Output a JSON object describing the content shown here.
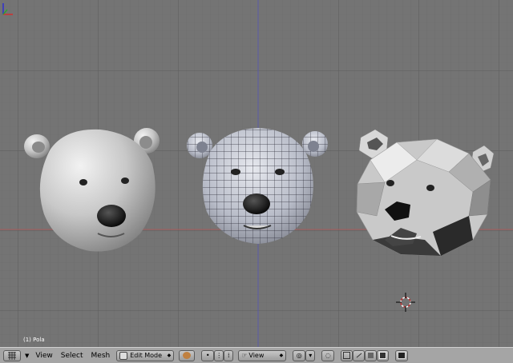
{
  "viewport": {
    "object_label": "(1) Pola",
    "background": "#747474",
    "grid_color": "#6a6a6a",
    "x_axis_color": "#b05050",
    "y_axis_color": "#5050b0"
  },
  "header": {
    "menus": [
      "View",
      "Select",
      "Mesh"
    ],
    "mode_label": "Edit Mode",
    "view_dropdown_label": "View"
  },
  "icons": {
    "window_type": "grid-icon",
    "menu_collapse": "triangle-down-icon",
    "mode": "bear-mesh-icon",
    "pivot_dots": [
      "dot-icon",
      "dots-icon",
      "dots-grid-icon"
    ],
    "view_hand": "hand-icon",
    "snap": "snap-icon",
    "proportional": "proportional-icon",
    "select_modes": [
      "vertex-select-icon",
      "edge-select-icon",
      "face-select-icon"
    ],
    "occlude": "occlude-icon",
    "render": "render-icon"
  }
}
